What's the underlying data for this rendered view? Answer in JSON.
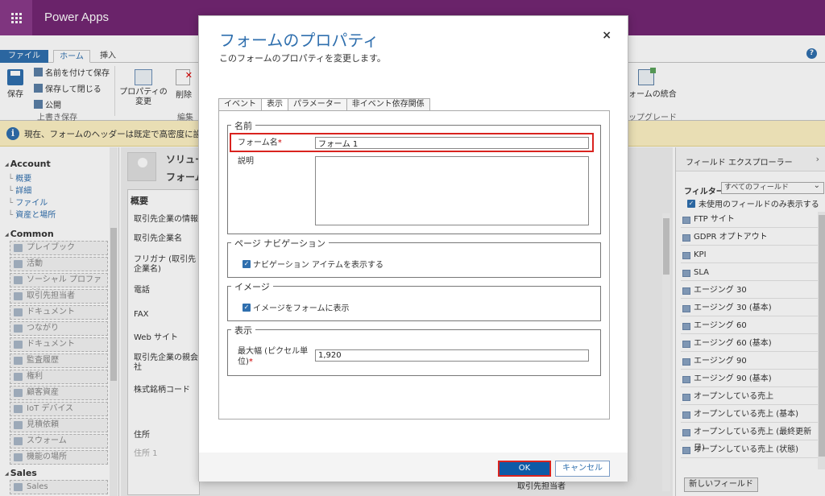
{
  "app": {
    "title": "Power Apps"
  },
  "ribbon": {
    "tabs": [
      "ファイル",
      "ホーム",
      "挿入"
    ],
    "save": "保存",
    "save_as": "名前を付けて保存",
    "save_close": "保存して閉じる",
    "publish": "公開",
    "group_save": "上書き保存",
    "form_props": "フォームのプロパティ",
    "form_props_l1": "プロパティの",
    "form_props_l2": "変更",
    "delete": "削除",
    "group_edit": "編集",
    "merge": "ォームの統合",
    "group_upgrade": "ップグレード"
  },
  "notice": {
    "text": "現在、フォームのヘッダーは既定で高密度に設定され、よ"
  },
  "leftnav": {
    "account": "Account",
    "account_links": [
      "概要",
      "詳細",
      "ファイル",
      "資産と場所"
    ],
    "common": "Common",
    "common_items": [
      "プレイブック",
      "活動",
      "ソーシャル プロファイル",
      "取引先担当者",
      "ドキュメント",
      "つながり",
      "ドキュメント",
      "監査履歴",
      "権利",
      "顧客資産",
      "IoT デバイス",
      "見積依頼",
      "スウォーム",
      "機能の場所"
    ],
    "sales": "Sales",
    "sales2": "Sales"
  },
  "canvas": {
    "title1": "ソリュー",
    "title2": "フォーム",
    "tab_title": "概要",
    "section": "取引先企業の情報",
    "fields": [
      "取引先企業名",
      "フリガナ (取引先企業名)",
      "電話",
      "FAX",
      "Web サイト",
      "取引先企業の親会社",
      "株式銘柄コード"
    ],
    "address": "住所",
    "address1": "住所 1",
    "contact": "取引先担当者"
  },
  "explorer": {
    "title": "フィールド エクスプローラー",
    "filter_label": "フィルター",
    "filter_value": "すべてのフィールド",
    "unused_only": "未使用のフィールドのみ表示する",
    "fields": [
      "FTP サイト",
      "GDPR オプトアウト",
      "KPI",
      "SLA",
      "エージング 30",
      "エージング 30 (基本)",
      "エージング 60",
      "エージング 60 (基本)",
      "エージング 90",
      "エージング 90 (基本)",
      "オープンしている売上",
      "オープンしている売上 (基本)",
      "オープンしている売上 (最終更新日)",
      "オープンしている売上 (状態)"
    ],
    "new_field": "新しいフィールド"
  },
  "dialog": {
    "title": "フォームのプロパティ",
    "subtitle": "このフォームのプロパティを変更します。",
    "close": "×",
    "tabs": [
      "イベント",
      "表示",
      "パラメーター",
      "非イベント依存関係"
    ],
    "active_tab": 1,
    "name_legend": "名前",
    "form_name_label": "フォーム名",
    "form_name_value": "フォーム 1",
    "description_label": "説明",
    "nav_legend": "ページ ナビゲーション",
    "nav_check": "ナビゲーション アイテムを表示する",
    "image_legend": "イメージ",
    "image_check": "イメージをフォームに表示",
    "display_legend": "表示",
    "max_width_label_1": "最大幅 (ピクセル単",
    "max_width_label_2": "位)",
    "max_width_value": "1,920",
    "ok": "OK",
    "cancel": "キャンセル"
  },
  "colors": {
    "brand": "#742774",
    "accent": "#2f6fae",
    "highlight": "#d9231f",
    "ok_button": "#0d5aa7",
    "notice": "#fdf1c4"
  }
}
